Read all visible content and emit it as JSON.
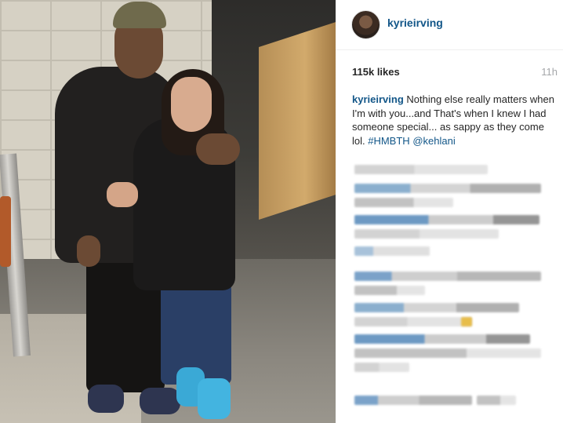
{
  "photo": {
    "description_icon": "photo-image"
  },
  "header": {
    "username": "kyrieirving",
    "avatar_icon": "profile-avatar"
  },
  "stats": {
    "likes": "115k likes",
    "time": "11h"
  },
  "caption": {
    "author": "kyrieirving",
    "text": " Nothing else really matters when I'm with you...and That's when I knew I had someone special... as sappy as they come lol. ",
    "hashtag": "#HMBTH",
    "mention": "@kehlani"
  },
  "colors": {
    "link": "#125688",
    "text": "#262626",
    "muted": "#a5a7aa",
    "divider": "#efefef"
  }
}
